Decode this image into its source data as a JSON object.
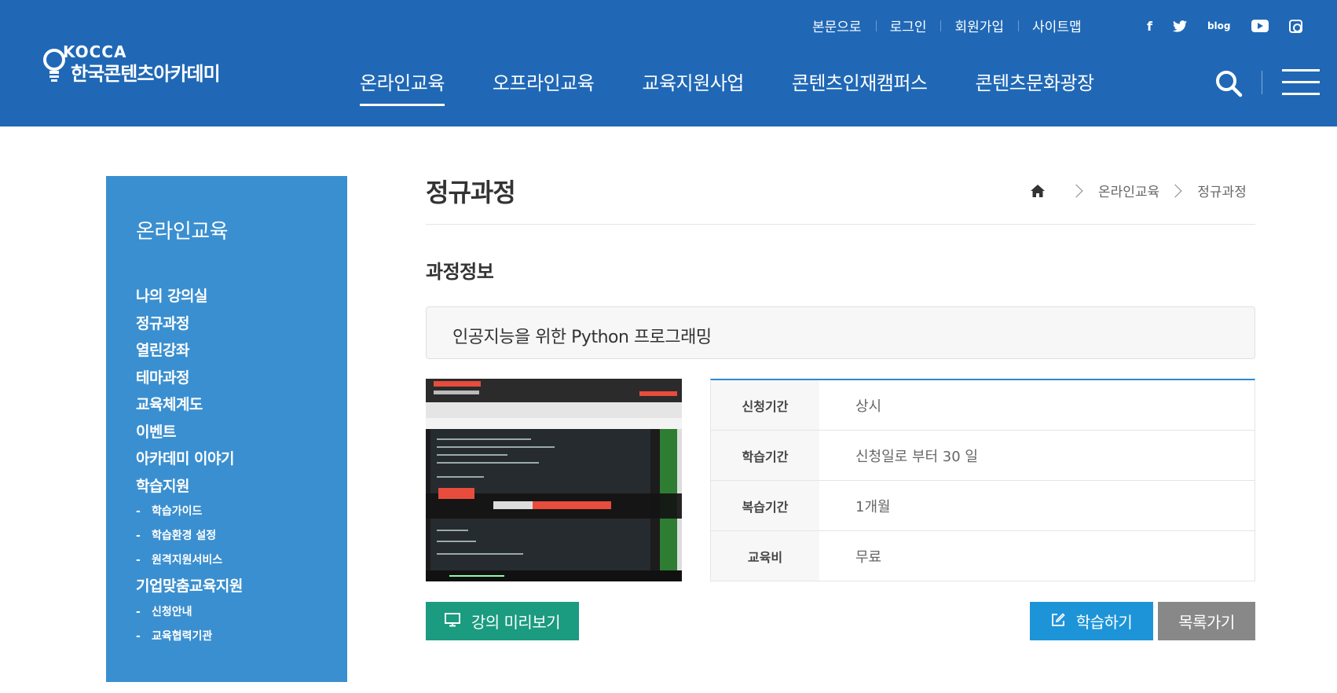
{
  "header": {
    "logo_en": "KOCCA",
    "logo_kr": "한국콘텐츠아카데미",
    "util_links": [
      "본문으로",
      "로그인",
      "회원가입",
      "사이트맵"
    ],
    "sns": {
      "facebook": "f",
      "twitter": "twitter-icon",
      "blog": "blog",
      "youtube": "youtube-icon",
      "instagram": "instagram-icon"
    },
    "gnb": [
      "온라인교육",
      "오프라인교육",
      "교육지원사업",
      "콘텐츠인재캠퍼스",
      "콘텐츠문화광장"
    ],
    "active_gnb": "온라인교육"
  },
  "sidebar": {
    "title": "온라인교육",
    "items": [
      {
        "label": "나의 강의실",
        "type": "main"
      },
      {
        "label": "정규과정",
        "type": "main"
      },
      {
        "label": "열린강좌",
        "type": "main"
      },
      {
        "label": "테마과정",
        "type": "main"
      },
      {
        "label": "교육체계도",
        "type": "main"
      },
      {
        "label": "이벤트",
        "type": "main"
      },
      {
        "label": "아카데미 이야기",
        "type": "main"
      },
      {
        "label": "학습지원",
        "type": "main"
      },
      {
        "label": "학습가이드",
        "type": "sub"
      },
      {
        "label": "학습환경 설정",
        "type": "sub"
      },
      {
        "label": "원격지원서비스",
        "type": "sub"
      },
      {
        "label": "기업맞춤교육지원",
        "type": "main"
      },
      {
        "label": "신청안내",
        "type": "sub"
      },
      {
        "label": "교육협력기관",
        "type": "sub"
      }
    ]
  },
  "main": {
    "page_title": "정규과정",
    "breadcrumb": [
      "온라인교육",
      "정규과정"
    ],
    "section_title": "과정정보",
    "course_name": "인공지능을 위한 Python 프로그래밍",
    "info": [
      {
        "label": "신청기간",
        "value": "상시"
      },
      {
        "label": "학습기간",
        "value": "신청일로 부터 30 일"
      },
      {
        "label": "복습기간",
        "value": "1개월"
      },
      {
        "label": "교육비",
        "value": "무료"
      }
    ],
    "buttons": {
      "preview": "강의 미리보기",
      "learn": "학습하기",
      "list": "목록가기"
    }
  },
  "colors": {
    "header_bg": "#2068b6",
    "sidebar_bg": "#3a8fd0",
    "preview_btn": "#1b9b7f",
    "learn_btn": "#1e94d8",
    "list_btn": "#888888",
    "table_accent": "#2a8ad6"
  }
}
